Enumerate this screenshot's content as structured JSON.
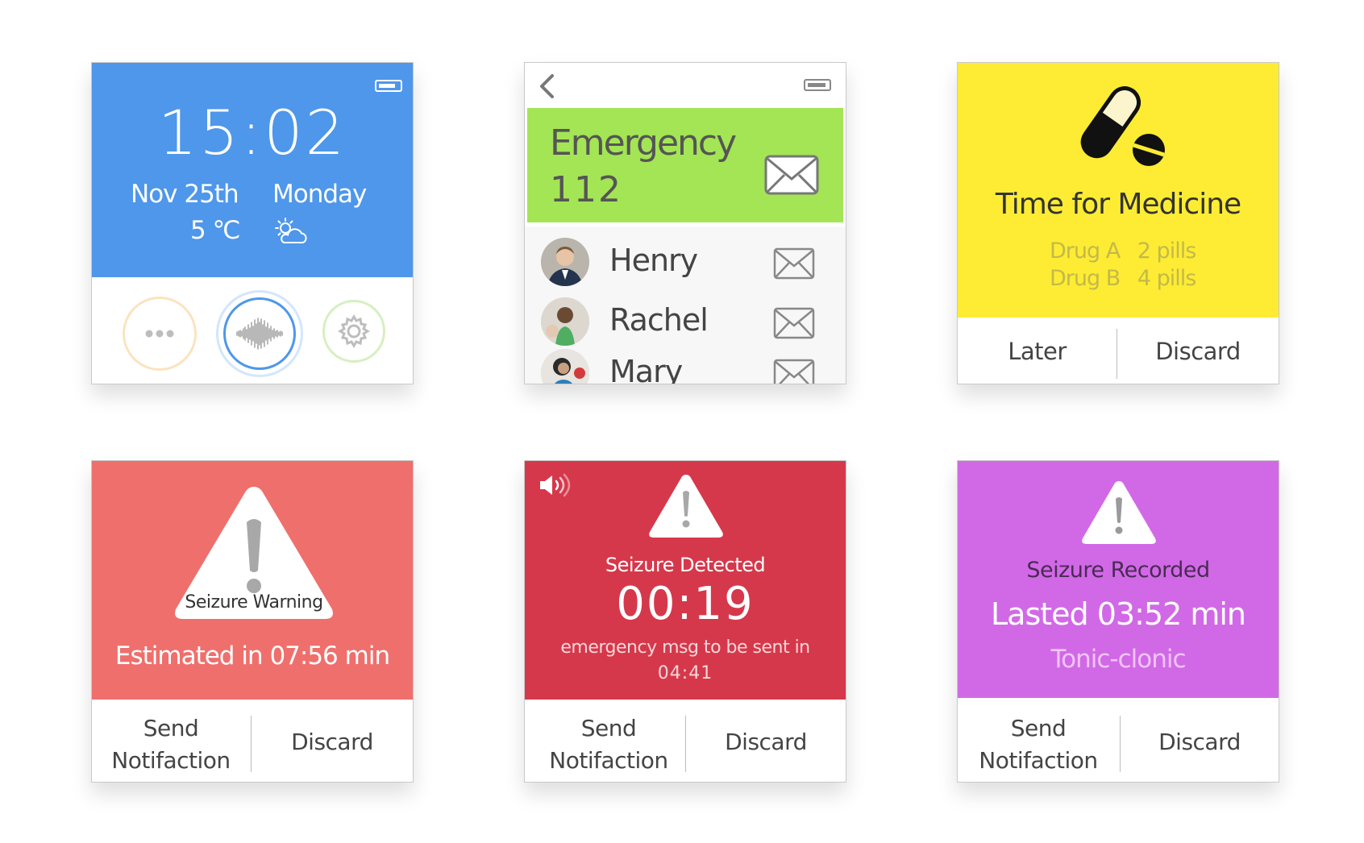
{
  "home": {
    "time": "15:02",
    "date": "Nov 25th",
    "day": "Monday",
    "temperature": "5 ℃",
    "battery_level": 0.75,
    "icons": [
      "battery-icon",
      "partly-cloudy-icon",
      "more-icon",
      "voice-icon",
      "settings-icon"
    ]
  },
  "contacts": {
    "emergency_label": "Emergency",
    "emergency_number": "112",
    "items": [
      {
        "name": "Henry"
      },
      {
        "name": "Rachel"
      },
      {
        "name": "Mary"
      }
    ],
    "icons": [
      "back-icon",
      "battery-icon",
      "envelope-icon"
    ]
  },
  "medicine": {
    "title": "Time for Medicine",
    "drugs": [
      {
        "name": "Drug A",
        "dose": "2 pills"
      },
      {
        "name": "Drug B",
        "dose": "4 pills"
      }
    ],
    "later_label": "Later",
    "discard_label": "Discard",
    "icon": "pills-icon"
  },
  "warning": {
    "triangle_label": "Seizure Warning",
    "estimate": "Estimated in 07:56 min",
    "send_label_1": "Send",
    "send_label_2": "Notifaction",
    "discard_label": "Discard",
    "color": "#ef6f6c"
  },
  "detected": {
    "title": "Seizure Detected",
    "timer": "00:19",
    "msg": "emergency msg to be sent in",
    "countdown": "04:41",
    "send_label_1": "Send",
    "send_label_2": "Notifaction",
    "discard_label": "Discard",
    "color": "#d6384b",
    "icons": [
      "speaker-icon",
      "warning-icon"
    ]
  },
  "recorded": {
    "title": "Seizure Recorded",
    "lasted": "Lasted 03:52 min",
    "type": "Tonic-clonic",
    "send_label_1": "Send",
    "send_label_2": "Notifaction",
    "discard_label": "Discard",
    "color": "#d169e6"
  }
}
